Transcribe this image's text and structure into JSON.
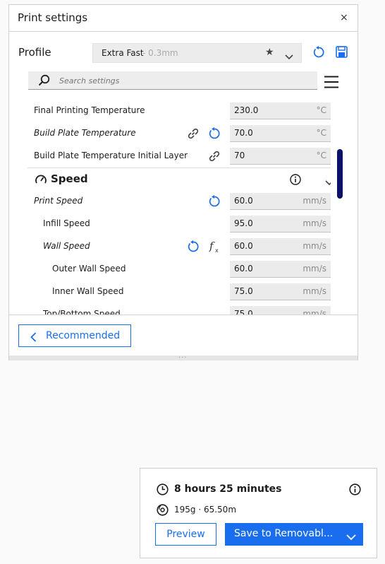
{
  "panel": {
    "title": "Print settings",
    "close": "×",
    "profile_label": "Profile",
    "profile_name": "Extra Fast",
    "profile_layer": "- 0.3mm",
    "search_placeholder": "Search settings",
    "recommended_label": "Recommended"
  },
  "settings": {
    "rows": [
      {
        "label": "Final Printing Temperature",
        "value": "230.0",
        "unit": "°C"
      },
      {
        "label": "Build Plate Temperature",
        "value": "70.0",
        "unit": "°C"
      },
      {
        "label": "Build Plate Temperature Initial Layer",
        "value": "70",
        "unit": "°C"
      },
      {
        "label": "Print Speed",
        "value": "60.0",
        "unit": "mm/s"
      },
      {
        "label": "Infill Speed",
        "value": "95.0",
        "unit": "mm/s"
      },
      {
        "label": "Wall Speed",
        "value": "60.0",
        "unit": "mm/s"
      },
      {
        "label": "Outer Wall Speed",
        "value": "60.0",
        "unit": "mm/s"
      },
      {
        "label": "Inner Wall Speed",
        "value": "75.0",
        "unit": "mm/s"
      },
      {
        "label": "Top/Bottom Speed",
        "value": "75.0",
        "unit": "mm/s"
      }
    ],
    "category": "Speed"
  },
  "print_info": {
    "time": "8 hours 25 minutes",
    "material": "195g · 65.50m",
    "preview_label": "Preview",
    "save_label": "Save to Removabl..."
  },
  "colors": {
    "accent": "#196ef0",
    "scrollbar": "#0a1166"
  }
}
